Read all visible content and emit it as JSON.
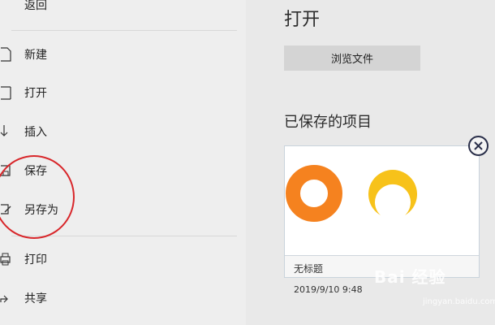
{
  "sidebar": {
    "back_label": "返回",
    "items": [
      {
        "label": "新建",
        "icon": "new-document-icon"
      },
      {
        "label": "打开",
        "icon": "open-icon"
      },
      {
        "label": "插入",
        "icon": "insert-icon"
      },
      {
        "label": "保存",
        "icon": "save-icon"
      },
      {
        "label": "另存为",
        "icon": "save-as-icon"
      },
      {
        "label": "打印",
        "icon": "print-icon"
      },
      {
        "label": "共享",
        "icon": "share-icon"
      }
    ]
  },
  "main": {
    "title": "打开",
    "browse_button_label": "浏览文件",
    "saved_heading": "已保存的项目",
    "saved_item": {
      "name": "无标题",
      "timestamp": "2019/9/10 9:48"
    }
  },
  "watermark": {
    "text": "Bai 经验",
    "sub": "jingyan.baidu.com"
  },
  "colors": {
    "annotation_circle": "#d8262a",
    "orange_ring": "#f5821f",
    "yellow_ring": "#f7c21a"
  }
}
